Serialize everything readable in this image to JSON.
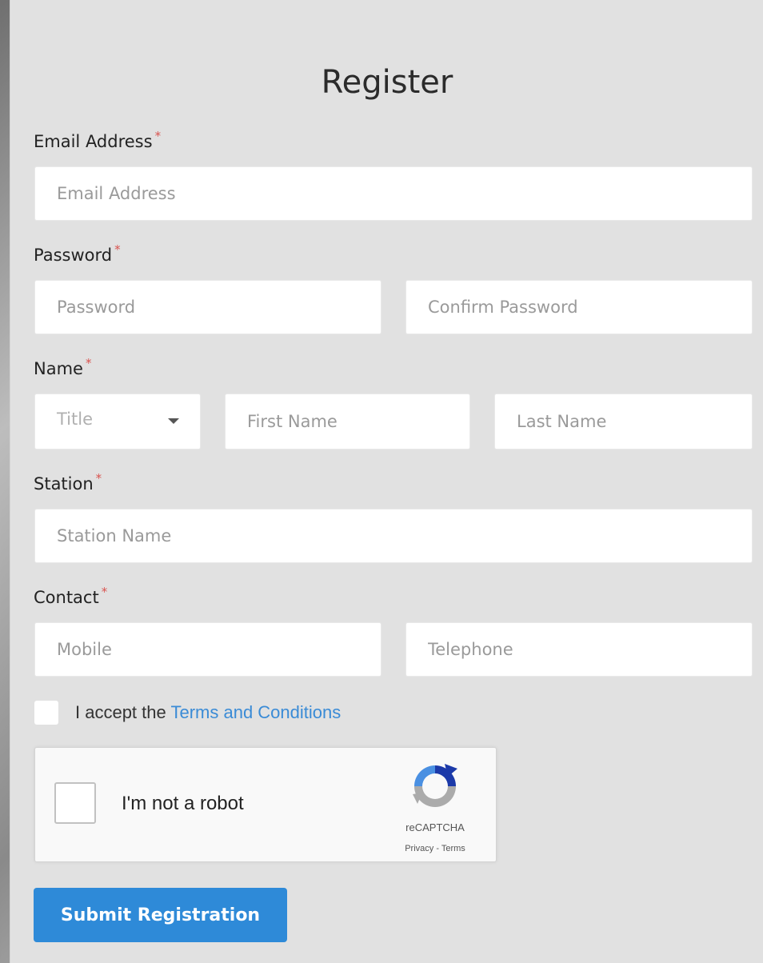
{
  "form": {
    "title": "Register",
    "required_marker": "*",
    "email": {
      "label": "Email Address",
      "placeholder": "Email Address",
      "value": ""
    },
    "password": {
      "label": "Password",
      "placeholder": "Password",
      "confirm_placeholder": "Confirm Password"
    },
    "name": {
      "label": "Name",
      "title_select": "Title",
      "first_placeholder": "First Name",
      "last_placeholder": "Last Name"
    },
    "station": {
      "label": "Station",
      "placeholder": "Station Name"
    },
    "contact": {
      "label": "Contact",
      "mobile_placeholder": "Mobile",
      "telephone_placeholder": "Telephone"
    },
    "terms": {
      "prefix": "I accept the",
      "link": "Terms and Conditions",
      "checked": false
    },
    "captcha": {
      "text": "I'm not a robot",
      "brand": "reCAPTCHA",
      "links": "Privacy - Terms",
      "checked": false
    },
    "submit_label": "Submit Registration"
  },
  "colors": {
    "accent": "#2e8ad8",
    "link": "#3a8bd6",
    "required": "#d9534f",
    "panel": "#e1e1e1"
  },
  "icons": {
    "select_caret": "chevron-down-icon",
    "captcha_logo": "recaptcha-icon"
  }
}
